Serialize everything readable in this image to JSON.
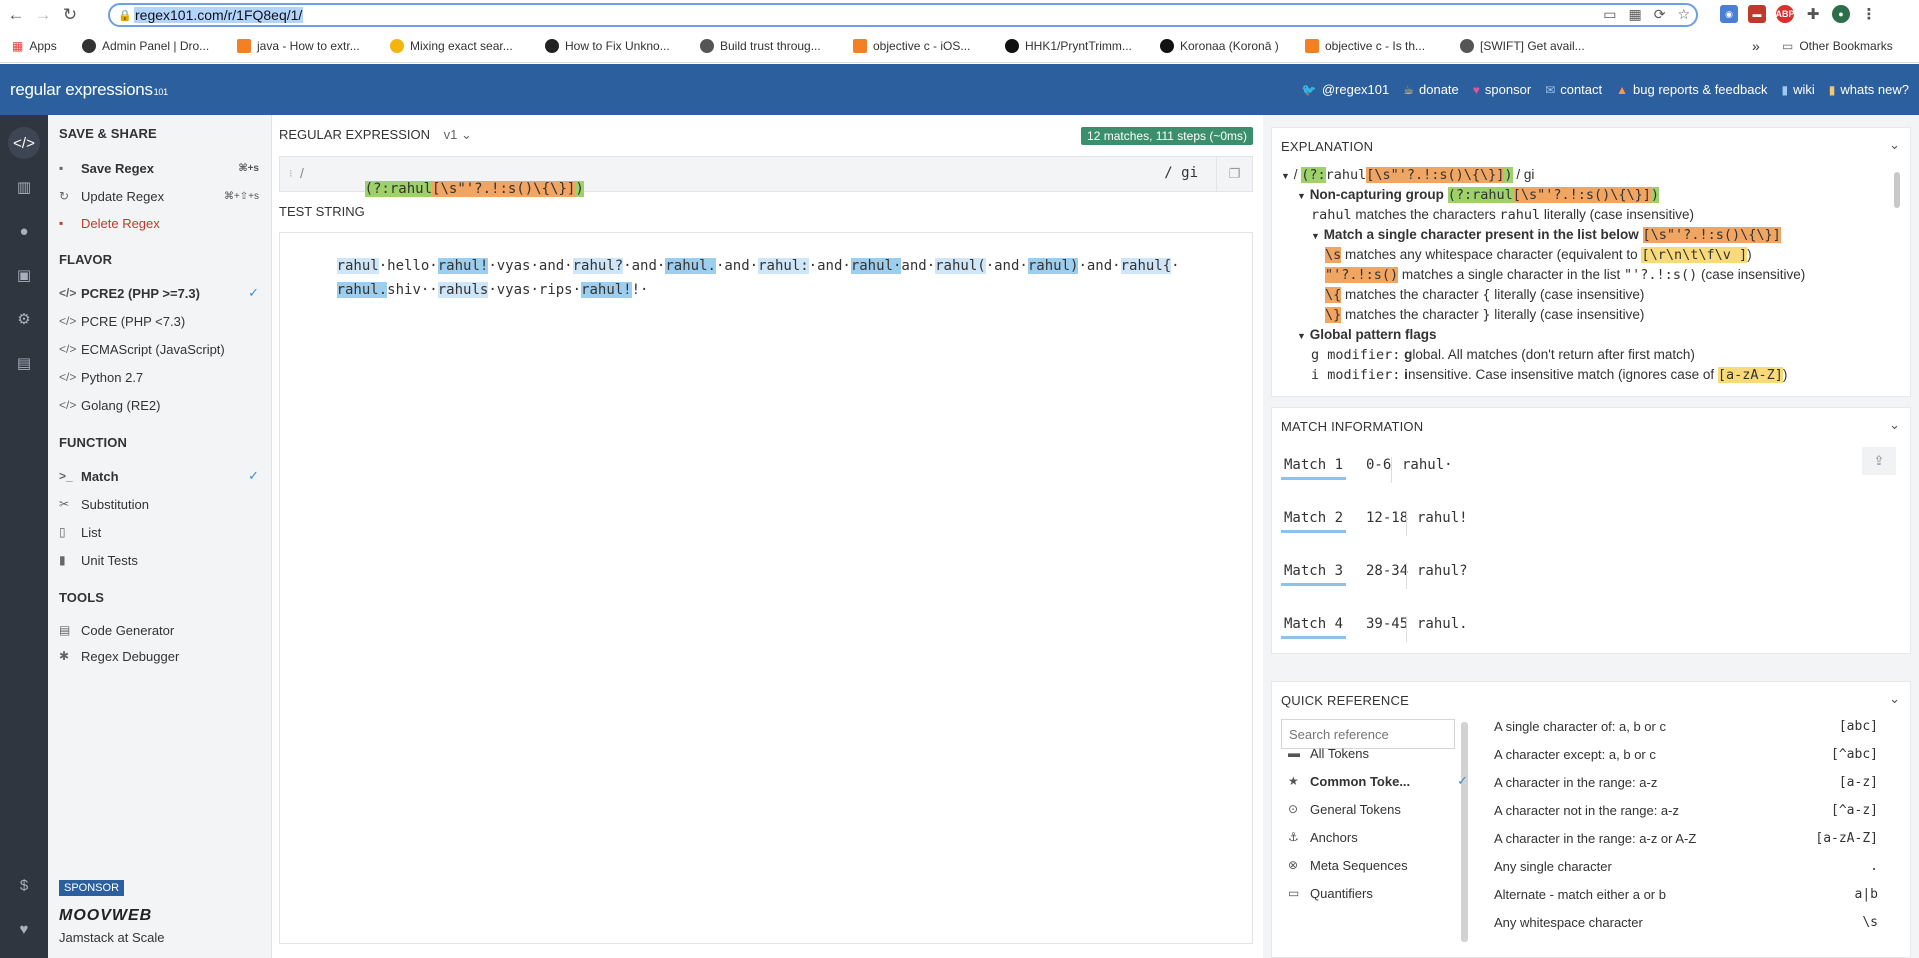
{
  "browser": {
    "url": "regex101.com/r/1FQ8eq/1/",
    "bookmarks": [
      {
        "label": "Apps",
        "color": "#e94235"
      },
      {
        "label": "Admin Panel | Dro...",
        "color": "#333333"
      },
      {
        "label": "java - How to extr...",
        "color": "#f48024"
      },
      {
        "label": "Mixing exact sear...",
        "color": "#f6b40e"
      },
      {
        "label": "How to Fix Unkno...",
        "color": "#222222"
      },
      {
        "label": "Build trust throug...",
        "color": "#555555"
      },
      {
        "label": "objective c - iOS...",
        "color": "#f48024"
      },
      {
        "label": "HHK1/PryntTrimm...",
        "color": "#111111"
      },
      {
        "label": "Koronaa (Koronā )",
        "color": "#111111"
      },
      {
        "label": "objective c - Is th...",
        "color": "#f48024"
      },
      {
        "label": "[SWIFT] Get avail...",
        "color": "#555555"
      }
    ],
    "more_label": "»",
    "other_bookmarks": "Other Bookmarks"
  },
  "header": {
    "logo_main": "regular expressions",
    "logo_version": "101",
    "links": [
      {
        "label": "@regex101",
        "icon": "twitter-icon",
        "glyph": "🐦"
      },
      {
        "label": "donate",
        "icon": "coffee-icon",
        "glyph": "☕"
      },
      {
        "label": "sponsor",
        "icon": "heart-icon",
        "glyph": "♥"
      },
      {
        "label": "contact",
        "icon": "mail-icon",
        "glyph": "✉"
      },
      {
        "label": "bug reports & feedback",
        "icon": "warning-icon",
        "glyph": "▲"
      },
      {
        "label": "wiki",
        "icon": "book-icon",
        "glyph": "▮"
      },
      {
        "label": "whats new?",
        "icon": "bookmark-icon",
        "glyph": "▮"
      }
    ]
  },
  "sidebar": {
    "save_share_header": "SAVE & SHARE",
    "save_regex": "Save Regex",
    "save_shortcut": "⌘+s",
    "update_regex": "Update Regex",
    "update_shortcut": "⌘+⇧+s",
    "delete_regex": "Delete Regex",
    "flavor_header": "FLAVOR",
    "flavors": [
      "PCRE2 (PHP >=7.3)",
      "PCRE (PHP <7.3)",
      "ECMAScript (JavaScript)",
      "Python 2.7",
      "Golang (RE2)"
    ],
    "function_header": "FUNCTION",
    "functions": [
      "Match",
      "Substitution",
      "List",
      "Unit Tests"
    ],
    "tools_header": "TOOLS",
    "tools": [
      "Code Generator",
      "Regex Debugger"
    ],
    "sponsor_badge": "SPONSOR",
    "sponsor_name": "MOOVWEB",
    "sponsor_tagline": "Jamstack at Scale"
  },
  "editor": {
    "regex_label": "REGULAR EXPRESSION",
    "version": "v1",
    "match_badge": "12 matches, 111 steps (~0ms)",
    "delimiter_open": "/",
    "regex_parts": [
      "(?:",
      "rahul",
      "[\\s\"'?.!:s()\\{\\}]",
      ")"
    ],
    "flags": "/ gi",
    "test_label": "TEST STRING",
    "line1": [
      "rahul",
      "·hello·",
      "rahul!",
      "·vyas·and·",
      "rahul?",
      "·and·",
      "rahul.",
      "·and·",
      "rahul:",
      "·and·",
      "rahul·",
      "and·",
      "rahul(",
      "·and·",
      "rahul)",
      "·and·",
      "rahul{",
      "·"
    ],
    "line2": [
      "rahul.",
      "shiv··",
      "rahuls",
      "·vyas·rips·",
      "rahul!",
      "!·"
    ]
  },
  "explanation": {
    "title": "EXPLANATION",
    "l1_prefix": "/",
    "l1_suffix": "/ gi",
    "l2_label": "Non-capturing group",
    "l3": [
      "rahul",
      "matches the characters",
      "rahul",
      "literally (case insensitive)"
    ],
    "l4_label": "Match a single character present in the list below",
    "l4_tok": "[\\s\"'?.!:s()\\{\\}]",
    "l5": [
      "\\s",
      "matches any whitespace character (equivalent to",
      "[\\r\\n\\t\\f\\v ]",
      ")"
    ],
    "l6": [
      "\"'?.!:s()",
      "matches a single character in the list",
      "\"'?.!:s()",
      "(case insensitive)"
    ],
    "l7": [
      "\\{",
      "matches the character",
      "{",
      "literally (case insensitive)"
    ],
    "l8": [
      "\\}",
      "matches the character",
      "}",
      "literally (case insensitive)"
    ],
    "l9_label": "Global pattern flags",
    "l10": [
      "g modifier:",
      "g",
      "lobal. All matches (don't return after first match)"
    ],
    "l11": [
      "i modifier:",
      "i",
      "nsensitive. Case insensitive match (ignores case of",
      "[a-zA-Z]",
      ")"
    ]
  },
  "match_info": {
    "title": "MATCH INFORMATION",
    "rows": [
      {
        "label": "Match 1",
        "range": "0-6",
        "value": "rahul·"
      },
      {
        "label": "Match 2",
        "range": "12-18",
        "value": "rahul!"
      },
      {
        "label": "Match 3",
        "range": "28-34",
        "value": "rahul?"
      },
      {
        "label": "Match 4",
        "range": "39-45",
        "value": "rahul."
      }
    ]
  },
  "quick_ref": {
    "title": "QUICK REFERENCE",
    "search_placeholder": "Search reference",
    "categories": [
      {
        "label": "All Tokens",
        "icon": "grid-icon",
        "glyph": "▬"
      },
      {
        "label": "Common Toke...",
        "icon": "star-icon",
        "glyph": "★"
      },
      {
        "label": "General Tokens",
        "icon": "circle-icon",
        "glyph": "⊙"
      },
      {
        "label": "Anchors",
        "icon": "anchor-icon",
        "glyph": "⚓"
      },
      {
        "label": "Meta Sequences",
        "icon": "close-circle-icon",
        "glyph": "⊗"
      },
      {
        "label": "Quantifiers",
        "icon": "quantifier-icon",
        "glyph": "▭"
      }
    ],
    "entries": [
      {
        "desc": "A single character of: a, b or c",
        "pattern": "[abc]"
      },
      {
        "desc": "A character except: a, b or c",
        "pattern": "[^abc]"
      },
      {
        "desc": "A character in the range: a-z",
        "pattern": "[a-z]"
      },
      {
        "desc": "A character not in the range: a-z",
        "pattern": "[^a-z]"
      },
      {
        "desc": "A character in the range: a-z or A-Z",
        "pattern": "[a-zA-Z]"
      },
      {
        "desc": "Any single character",
        "pattern": "."
      },
      {
        "desc": "Alternate - match either a or b",
        "pattern": "a|b"
      },
      {
        "desc": "Any whitespace character",
        "pattern": "\\s"
      }
    ]
  }
}
